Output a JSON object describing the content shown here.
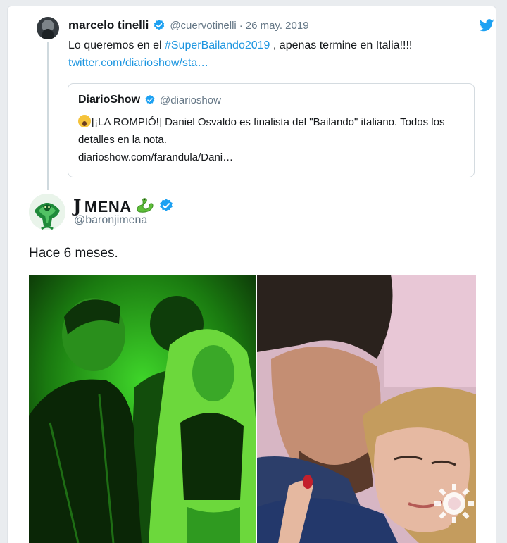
{
  "parent_tweet": {
    "name": "marcelo tinelli",
    "handle": "@cuervotinelli",
    "separator": "·",
    "date": "26 may. 2019",
    "text_before": "Lo queremos en el ",
    "hashtag": "#SuperBailando2019",
    "text_after": " , apenas termine en Italia!!!! ",
    "link": "twitter.com/diarioshow/sta…",
    "icons": {
      "avatar": "avatar",
      "verified": "verified-badge-icon",
      "brand": "twitter-bird-icon"
    }
  },
  "quoted_tweet": {
    "name": "DiarioShow",
    "handle": "@diarioshow",
    "text": "[¡LA ROMPIÓ!] Daniel Osvaldo es finalista del \"Bailando\" italiano. Todos los detalles en la nota.",
    "link": "diarioshow.com/farandula/Dani…",
    "emoji": "screaming-face-emoji"
  },
  "main_tweet": {
    "name_prefix": "J",
    "name": "MENA",
    "handle": "@baronjimena",
    "text": "Hace 6 meses.",
    "icons": {
      "avatar": "cobra-avatar",
      "decoration": "snake-emoji-icon",
      "verified": "verified-badge-icon"
    }
  },
  "media": {
    "left_photo": "green-stage-dance-photo",
    "right_photo": "tv-show-kiss-photo",
    "watermark": "tv-channel-sun-logo"
  },
  "colors": {
    "link": "#1b95e0",
    "verified": "#1da1f2",
    "secondary_text": "#657786",
    "green_tint": "#22c21a"
  }
}
